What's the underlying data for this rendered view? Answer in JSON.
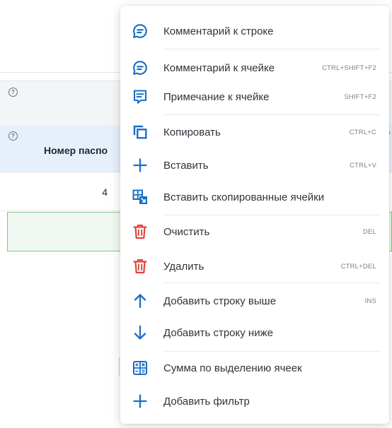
{
  "table": {
    "column_header": "Номер паспо",
    "cell_value": "4",
    "help_glyph": "?",
    "right_edge_glyph": "?"
  },
  "menu": {
    "items": [
      {
        "id": "comment-row",
        "label": "Комментарий к строке",
        "shortcut": "",
        "icon": "comment-icon",
        "color": "#1a6fc4"
      },
      {
        "id": "comment-cell",
        "label": "Комментарий к ячейке",
        "shortcut": "CTRL+SHIFT+F2",
        "icon": "comment-icon",
        "color": "#1a6fc4"
      },
      {
        "id": "note-cell",
        "label": "Примечание к ячейке",
        "shortcut": "SHIFT+F2",
        "icon": "note-icon",
        "color": "#1a6fc4"
      },
      {
        "id": "copy",
        "label": "Копировать",
        "shortcut": "CTRL+C",
        "icon": "copy-icon",
        "color": "#1a6fc4"
      },
      {
        "id": "paste",
        "label": "Вставить",
        "shortcut": "CTRL+V",
        "icon": "plus-icon",
        "color": "#1a6fc4"
      },
      {
        "id": "paste-cells",
        "label": "Вставить скопированные ячейки",
        "shortcut": "",
        "icon": "paste-cells-icon",
        "color": "#1a6fc4"
      },
      {
        "id": "clear",
        "label": "Очистить",
        "shortcut": "DEL",
        "icon": "trash-icon",
        "color": "#e0453a"
      },
      {
        "id": "delete",
        "label": "Удалить",
        "shortcut": "CTRL+DEL",
        "icon": "trash-icon",
        "color": "#e0453a"
      },
      {
        "id": "add-above",
        "label": "Добавить строку выше",
        "shortcut": "INS",
        "icon": "arrow-up-icon",
        "color": "#1a6fc4"
      },
      {
        "id": "add-below",
        "label": "Добавить строку ниже",
        "shortcut": "",
        "icon": "arrow-down-icon",
        "color": "#1a6fc4"
      },
      {
        "id": "sum",
        "label": "Сумма по выделению ячеек",
        "shortcut": "",
        "icon": "calculator-icon",
        "color": "#1a6fc4"
      },
      {
        "id": "filter",
        "label": "Добавить фильтр",
        "shortcut": "",
        "icon": "plus-icon",
        "color": "#1a6fc4"
      }
    ]
  },
  "colors": {
    "accent": "#1a6fc4",
    "danger": "#e0453a",
    "selected_border": "#7cc98a",
    "header_highlight": "#e6f0fb"
  }
}
